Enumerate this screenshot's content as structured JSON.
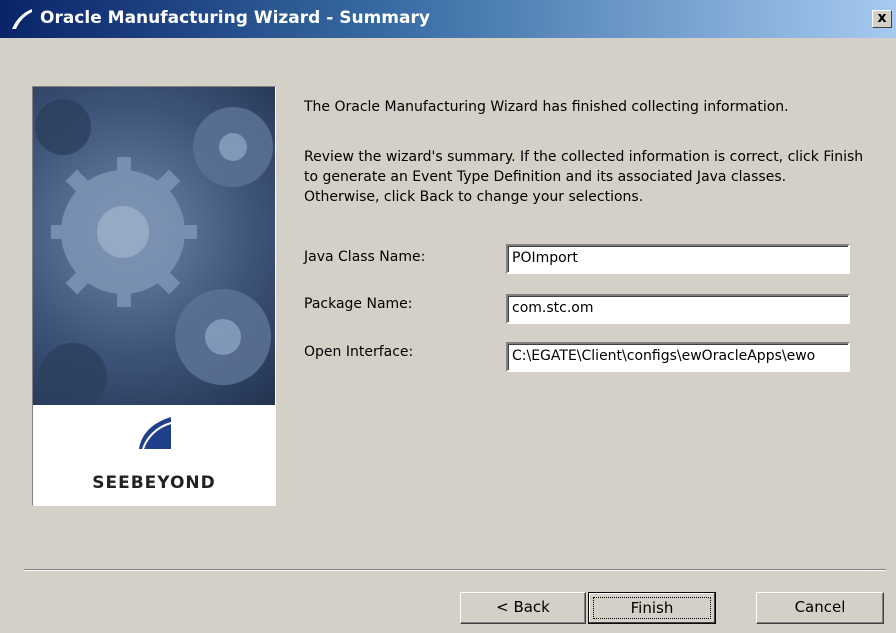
{
  "window": {
    "title": "Oracle Manufacturing Wizard - Summary",
    "close_label": "x"
  },
  "side_panel": {
    "logo_text": "SEEBEYOND"
  },
  "content": {
    "intro": "The Oracle Manufacturing Wizard has finished collecting information.",
    "instructions": "Review the wizard's summary.  If the collected information is correct, click Finish to generate an Event Type Definition and its associated Java classes.  Otherwise, click Back to change your selections."
  },
  "fields": {
    "java_class_name": {
      "label": "Java Class Name:",
      "value": "POImport"
    },
    "package_name": {
      "label": "Package Name:",
      "value": "com.stc.om"
    },
    "open_interface": {
      "label": "Open Interface:",
      "value": "C:\\EGATE\\Client\\configs\\ewOracleApps\\ewo"
    }
  },
  "buttons": {
    "back": "< Back",
    "finish": "Finish",
    "cancel": "Cancel"
  },
  "colors": {
    "titlebar_start": "#0a246a",
    "titlebar_end": "#a6caf0",
    "dialog_bg": "#d4d0c8"
  }
}
